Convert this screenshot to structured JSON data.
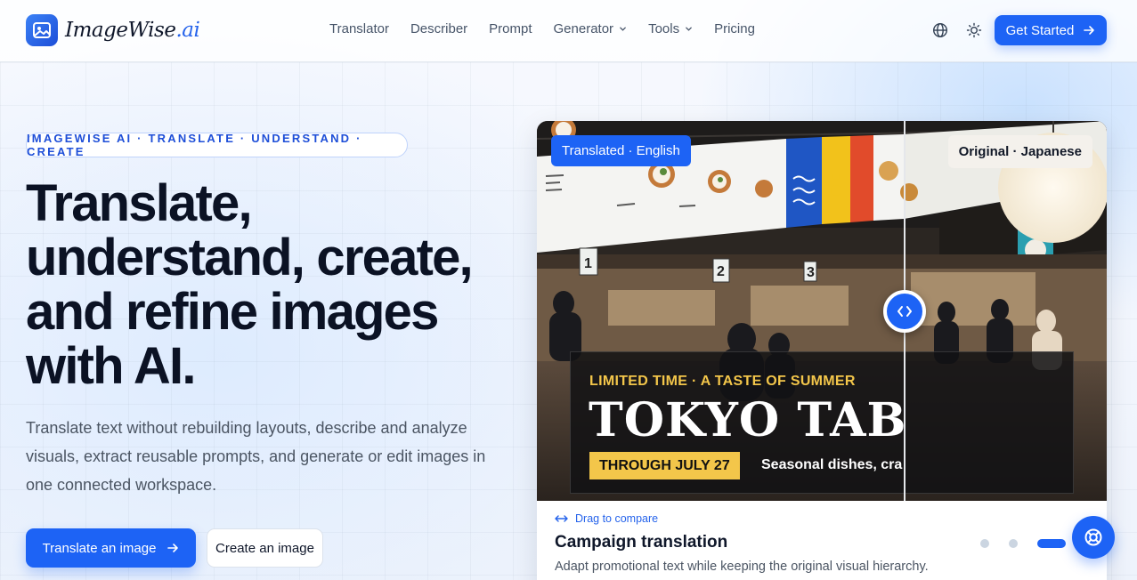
{
  "brand": {
    "name": "ImageWise",
    "suffix": ".ai"
  },
  "nav": {
    "items": [
      {
        "label": "Translator",
        "has_dropdown": false
      },
      {
        "label": "Describer",
        "has_dropdown": false
      },
      {
        "label": "Prompt",
        "has_dropdown": false
      },
      {
        "label": "Generator",
        "has_dropdown": true
      },
      {
        "label": "Tools",
        "has_dropdown": true
      },
      {
        "label": "Pricing",
        "has_dropdown": false
      }
    ],
    "icons": [
      "globe-icon",
      "sun-icon"
    ],
    "cta_label": "Get Started"
  },
  "hero": {
    "eyebrow": "IMAGEWISE AI · TRANSLATE · UNDERSTAND · CREATE",
    "headline_lines": [
      "Translate,",
      "understand, create,",
      "and refine images",
      "with AI."
    ],
    "subtext": "Translate text without rebuilding layouts, describe and analyze visuals, extract reusable prompts, and generate or edit images in one connected workspace.",
    "primary_button": "Translate an image",
    "secondary_button": "Create an image"
  },
  "compare": {
    "left_badge": "Translated · English",
    "right_badge": "Original · Japanese",
    "promo": {
      "kicker": "LIMITED TIME · A TASTE OF SUMMER",
      "title": "TOKYO TABLE",
      "date": "THROUGH JULY 27",
      "seasonal": "Seasonal dishes, cra"
    },
    "drag_hint": "Drag to compare",
    "card_title": "Campaign translation",
    "card_desc": "Adapt promotional text while keeping the original visual hierarchy.",
    "slides": 3,
    "active_slide": 3
  },
  "colors": {
    "accent": "#1d63f5",
    "promo_yellow": "#f3c64a"
  }
}
